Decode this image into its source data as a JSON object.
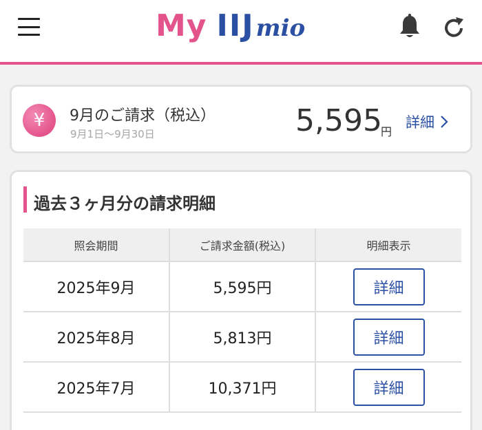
{
  "header": {
    "logo": {
      "my": "My",
      "iij": "IIJ",
      "mio": "mio"
    },
    "icons": {
      "menu": "hamburger-menu-icon",
      "notifications": "bell-icon",
      "refresh": "refresh-icon"
    },
    "colors": {
      "accent_pink": "#e4548c",
      "brand_blue": "#2b4fa3"
    }
  },
  "summary": {
    "icon_symbol": "¥",
    "title": "9月のご請求（税込）",
    "period": "9月1日～9月30日",
    "amount": "5,595",
    "currency": "円",
    "detail_label": "詳細"
  },
  "history": {
    "title": "過去３ヶ月分の請求明細",
    "columns": [
      "照会期間",
      "ご請求金額(税込)",
      "明細表示"
    ],
    "rows": [
      {
        "period": "2025年9月",
        "amount": "5,595円",
        "action": "詳細"
      },
      {
        "period": "2025年8月",
        "amount": "5,813円",
        "action": "詳細"
      },
      {
        "period": "2025年7月",
        "amount": "10,371円",
        "action": "詳細"
      }
    ]
  }
}
